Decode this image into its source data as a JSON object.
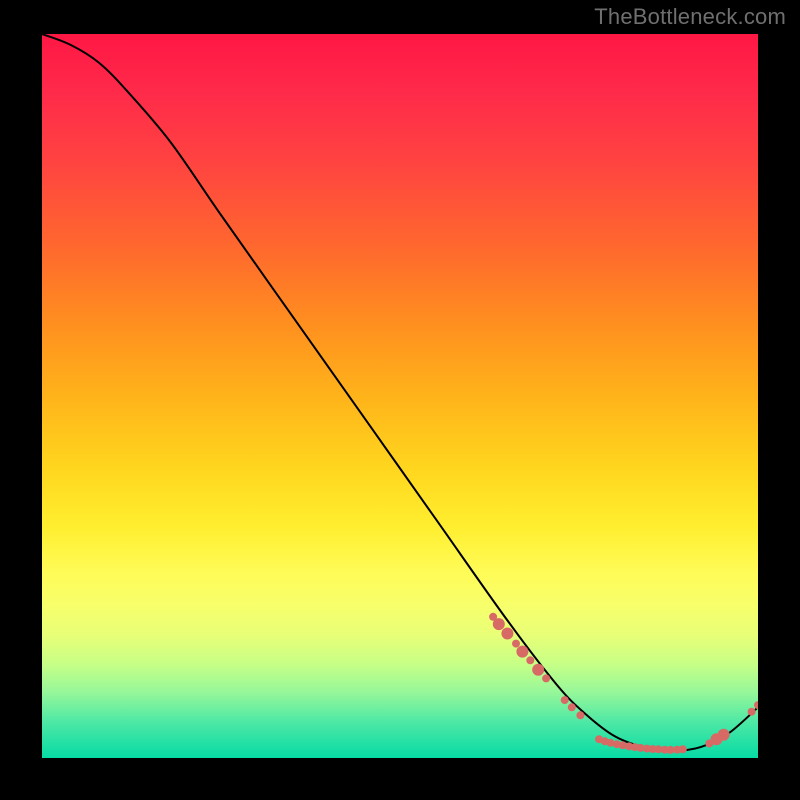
{
  "watermark": "TheBottleneck.com",
  "chart_data": {
    "type": "line",
    "title": "",
    "xlabel": "",
    "ylabel": "",
    "xlim": [
      0,
      100
    ],
    "ylim": [
      0,
      100
    ],
    "series": [
      {
        "name": "bottleneck-curve",
        "x": [
          0,
          4,
          8,
          12,
          18,
          25,
          35,
          45,
          55,
          65,
          72,
          76,
          80,
          84,
          88,
          92,
          96,
          100
        ],
        "y": [
          100,
          98.5,
          96,
          92,
          85,
          75,
          61,
          47,
          33,
          19,
          10,
          6,
          3,
          1.5,
          1,
          1.5,
          3.5,
          7
        ]
      }
    ],
    "scatter": [
      {
        "x": 63.0,
        "y": 19.5,
        "r": 4
      },
      {
        "x": 63.8,
        "y": 18.5,
        "r": 6
      },
      {
        "x": 65.0,
        "y": 17.2,
        "r": 6
      },
      {
        "x": 66.2,
        "y": 15.8,
        "r": 4
      },
      {
        "x": 67.1,
        "y": 14.7,
        "r": 6
      },
      {
        "x": 68.2,
        "y": 13.5,
        "r": 4
      },
      {
        "x": 69.3,
        "y": 12.2,
        "r": 6
      },
      {
        "x": 70.4,
        "y": 11.0,
        "r": 4
      },
      {
        "x": 73.0,
        "y": 8.0,
        "r": 4
      },
      {
        "x": 74.0,
        "y": 7.0,
        "r": 4
      },
      {
        "x": 75.2,
        "y": 5.9,
        "r": 4
      },
      {
        "x": 77.8,
        "y": 2.6,
        "r": 4
      },
      {
        "x": 78.6,
        "y": 2.3,
        "r": 4
      },
      {
        "x": 79.4,
        "y": 2.1,
        "r": 4
      },
      {
        "x": 80.3,
        "y": 1.9,
        "r": 4
      },
      {
        "x": 81.1,
        "y": 1.75,
        "r": 4
      },
      {
        "x": 82.0,
        "y": 1.6,
        "r": 4
      },
      {
        "x": 82.8,
        "y": 1.5,
        "r": 4
      },
      {
        "x": 83.6,
        "y": 1.4,
        "r": 4
      },
      {
        "x": 84.5,
        "y": 1.3,
        "r": 4
      },
      {
        "x": 85.3,
        "y": 1.25,
        "r": 4
      },
      {
        "x": 86.1,
        "y": 1.2,
        "r": 4
      },
      {
        "x": 87.0,
        "y": 1.15,
        "r": 4
      },
      {
        "x": 87.8,
        "y": 1.12,
        "r": 4
      },
      {
        "x": 88.7,
        "y": 1.14,
        "r": 4
      },
      {
        "x": 89.5,
        "y": 1.2,
        "r": 4
      },
      {
        "x": 93.2,
        "y": 2.0,
        "r": 4
      },
      {
        "x": 94.2,
        "y": 2.6,
        "r": 6
      },
      {
        "x": 95.2,
        "y": 3.2,
        "r": 6
      },
      {
        "x": 99.1,
        "y": 6.4,
        "r": 4
      },
      {
        "x": 100.0,
        "y": 7.3,
        "r": 4
      }
    ],
    "gradient_stops": [
      {
        "pos": 0,
        "color": "#ff1744"
      },
      {
        "pos": 50,
        "color": "#ffb31a"
      },
      {
        "pos": 78,
        "color": "#fffb55"
      },
      {
        "pos": 100,
        "color": "#06dba5"
      }
    ]
  }
}
